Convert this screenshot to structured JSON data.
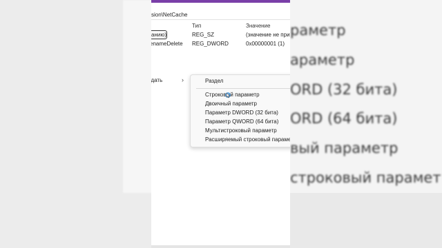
{
  "address": {
    "path": "sion\\NetCache"
  },
  "columns": {
    "name": "",
    "type": "Тип",
    "value": "Значение"
  },
  "rows": [
    {
      "name": "анию)",
      "type": "REG_SZ",
      "value": "(значение не при"
    },
    {
      "name": "enameDelete",
      "type": "REG_DWORD",
      "value": "0x00000001 (1)"
    }
  ],
  "context_menu": {
    "parent_label": "здать",
    "arrow": "›",
    "items": [
      {
        "label": "Раздел"
      },
      {
        "label": "Строковый параметр"
      },
      {
        "label": "Двоичный параметр"
      },
      {
        "label": "Параметр DWORD (32 бита)"
      },
      {
        "label": "Параметр QWORD (64 бита)"
      },
      {
        "label": "Мультистроковый параметр"
      },
      {
        "label": "Расширяемый строковый параме"
      }
    ]
  },
  "background_zoom_text": [
    "раметр",
    "араметр",
    "ORD (32 бита)",
    "ORD (64 бита)",
    "вый параметр",
    "строковый парамет"
  ],
  "colors": {
    "titlebar_accent": "#7a3fa8",
    "cursor": "#3a8fd8"
  }
}
